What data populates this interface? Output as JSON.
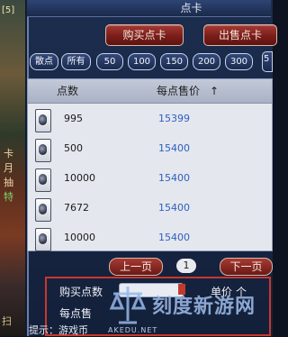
{
  "window": {
    "title": "点卡"
  },
  "left_fragments": [
    "卡",
    "月",
    "抽",
    "特",
    "扫"
  ],
  "top_left_fragment": "[5]",
  "actions": {
    "buy_label": "购买点卡",
    "sell_label": "出售点卡"
  },
  "filters": [
    "散点",
    "所有",
    "50",
    "100",
    "150",
    "200",
    "300",
    "5"
  ],
  "table": {
    "col_qty": "点数",
    "col_price": "每点售价",
    "sort_arrow": "↑",
    "rows": [
      {
        "qty": "995",
        "price": "15399"
      },
      {
        "qty": "500",
        "price": "15400"
      },
      {
        "qty": "10000",
        "price": "15400"
      },
      {
        "qty": "7672",
        "price": "15400"
      },
      {
        "qty": "10000",
        "price": "15400"
      }
    ]
  },
  "pager": {
    "prev_label": "上一页",
    "page": "1",
    "next_label": "下一页"
  },
  "buy_form": {
    "qty_label": "购买点数",
    "price_label": "单价",
    "per_point_label": "每点售",
    "suffix": "个"
  },
  "footer_hint": "提示：游戏币",
  "watermark": {
    "text": "刻度新游网",
    "sub": "AKEDU.NET"
  },
  "colors": {
    "accent_red": "#a63a34",
    "price_blue": "#2f5fbf",
    "panel_bg": "#1c2d4e"
  }
}
